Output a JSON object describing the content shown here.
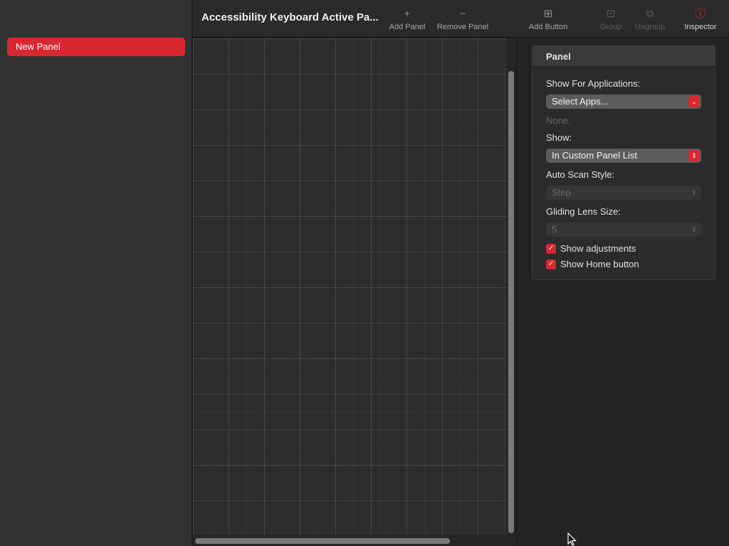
{
  "sidebar": {
    "items": [
      {
        "label": "New Panel",
        "selected": true
      }
    ]
  },
  "toolbar": {
    "title": "Accessibility Keyboard Active Pa...",
    "buttons": [
      {
        "label": "Add Panel",
        "icon": "plus-icon",
        "glyph": "+",
        "enabled": true
      },
      {
        "label": "Remove Panel",
        "icon": "minus-icon",
        "glyph": "−",
        "enabled": true
      },
      {
        "label": "Add Button",
        "icon": "add-button-icon",
        "glyph": "⊞",
        "enabled": true
      },
      {
        "label": "Group",
        "icon": "group-icon",
        "glyph": "⊡",
        "enabled": false
      },
      {
        "label": "Ungroup",
        "icon": "ungroup-icon",
        "glyph": "⧉",
        "enabled": false
      },
      {
        "label": "Inspector",
        "icon": "info-icon",
        "glyph": "ⓘ",
        "enabled": true,
        "active": true
      }
    ]
  },
  "inspector": {
    "header": "Panel",
    "show_for_apps_label": "Show For Applications:",
    "select_apps_value": "Select Apps...",
    "apps_hint": "None.",
    "show_label": "Show:",
    "show_value": "In Custom Panel List",
    "auto_scan_label": "Auto Scan Style:",
    "auto_scan_value": "Step",
    "gliding_lens_label": "Gliding Lens Size:",
    "gliding_lens_value": "5",
    "show_adjustments_label": "Show adjustments",
    "show_adjustments_checked": true,
    "show_home_label": "Show Home button",
    "show_home_checked": true
  },
  "colors": {
    "accent": "#d9282f",
    "sidebar_bg": "#323232",
    "canvas_bg": "#2c2d2c",
    "inspector_bg": "#232323"
  }
}
